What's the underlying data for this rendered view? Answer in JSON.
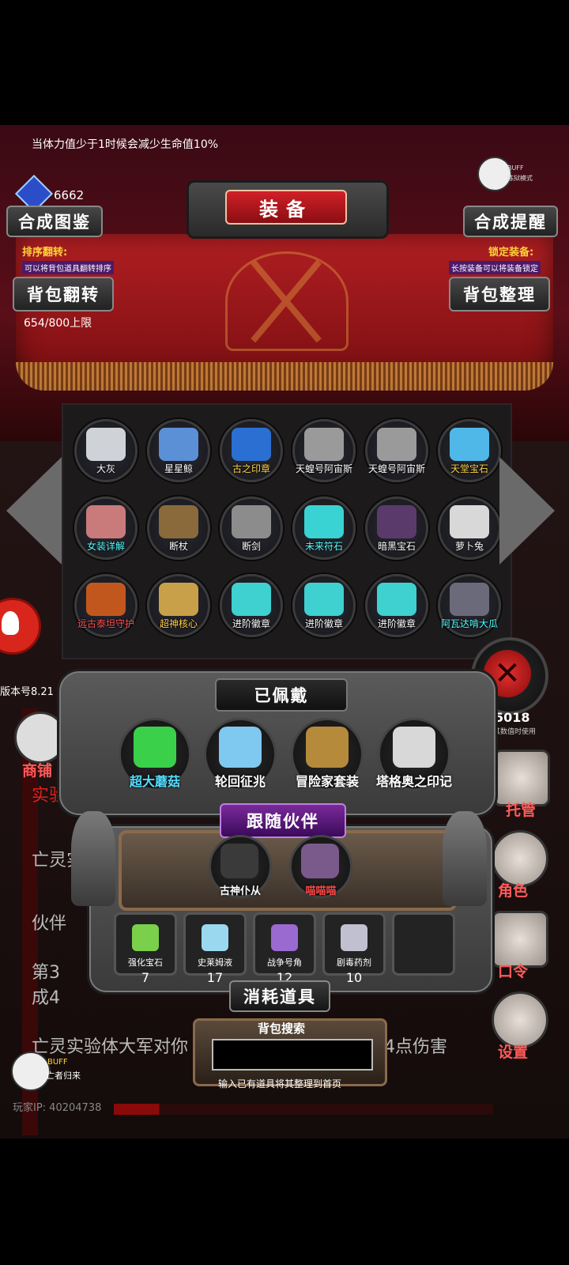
{
  "status_text": "当体力值少于1时候会减少生命值10%",
  "gems": "6662",
  "buff_top": {
    "badge": "BUFF",
    "mode": "炼狱模式"
  },
  "title": "装备",
  "buttons": {
    "synth_guide": "合成图鉴",
    "synth_remind": "合成提醒",
    "bag_flip": "背包翻转",
    "bag_sort": "背包整理"
  },
  "hints": {
    "flip_title": "排序翻转:",
    "flip_desc": "可以将背包道具翻转排序",
    "lock_title": "锁定装备:",
    "lock_desc": "长按装备可以将装备锁定"
  },
  "capacity": "654/800上限",
  "bag_items": [
    {
      "label": "大灰",
      "color": "white",
      "art": "#cfd3d8"
    },
    {
      "label": "星星鲸",
      "color": "white",
      "art": "#5b8fd6"
    },
    {
      "label": "古之印章",
      "color": "yellow",
      "art": "#2a6fd1"
    },
    {
      "label": "天蝗号阿宙斯",
      "color": "white",
      "art": "#9a9a9a"
    },
    {
      "label": "天蝗号阿宙斯",
      "color": "white",
      "art": "#9a9a9a"
    },
    {
      "label": "天堂宝石",
      "color": "yellow",
      "art": "#4fb8e8"
    },
    {
      "label": "女装详解",
      "color": "cyan",
      "art": "#c97a7a"
    },
    {
      "label": "断杖",
      "color": "white",
      "art": "#8a6a3a"
    },
    {
      "label": "断剑",
      "color": "white",
      "art": "#8c8c8c"
    },
    {
      "label": "未来符石",
      "color": "cyan",
      "art": "#39d3d3"
    },
    {
      "label": "暗黑宝石",
      "color": "white",
      "art": "#5a3a6a"
    },
    {
      "label": "萝卜兔",
      "color": "white",
      "art": "#d8d8d8"
    },
    {
      "label": "远古泰坦守护",
      "color": "red",
      "art": "#c2571e"
    },
    {
      "label": "超神核心",
      "color": "yellow",
      "art": "#c9a04a"
    },
    {
      "label": "进阶徽章",
      "color": "white",
      "art": "#3fd0d0"
    },
    {
      "label": "进阶徽章",
      "color": "white",
      "art": "#3fd0d0"
    },
    {
      "label": "进阶徽章",
      "color": "white",
      "art": "#3fd0d0"
    },
    {
      "label": "阿瓦达啃大瓜",
      "color": "cyan",
      "art": "#6a6a7a"
    }
  ],
  "version": "版本号8.21",
  "shop_label": "商铺",
  "equipped_title": "已佩戴",
  "equipped": [
    {
      "label": "超大蘑菇",
      "color": "#55ddff",
      "art": "#3ad04a"
    },
    {
      "label": "轮回征兆",
      "color": "#ffffff",
      "art": "#7fc8f0"
    },
    {
      "label": "冒险家套装",
      "color": "#ffffff",
      "art": "#b58a3a"
    },
    {
      "label": "塔格奥之印记",
      "color": "#ffffff",
      "art": "#d8d8d8"
    }
  ],
  "partner_title": "跟随伙伴",
  "partners": [
    {
      "label": "古神仆从",
      "color": "#ffffff",
      "art": "#3a3a3a"
    },
    {
      "label": "喵喵喵",
      "color": "#ff4a4a",
      "art": "#7a5a8a"
    }
  ],
  "consumables": [
    {
      "label": "强化宝石",
      "count": "7",
      "art": "#7ad04a"
    },
    {
      "label": "史莱姆液",
      "count": "17",
      "art": "#9ad8f0"
    },
    {
      "label": "战争号角",
      "count": "12",
      "art": "#9a6ad0"
    },
    {
      "label": "剧毒药剂",
      "count": "10",
      "art": "#c0c0d0"
    }
  ],
  "consumables_title": "消耗道具",
  "search": {
    "title": "背包搜索",
    "hint": "输入已有道具将其整理到首页",
    "placeholder": ""
  },
  "right_panel": {
    "value": "5018",
    "desc": "其数值时使用"
  },
  "side_labels": {
    "manage": "托管",
    "role": "角色",
    "code": "口令",
    "settings": "设置"
  },
  "bg_log": {
    "line1": "实验",
    "line2": "亡灵实",
    "line3": "伙伴",
    "line4": "第3",
    "line5": "成4",
    "line6": "亡灵实验体大军对你",
    "line6b": "4点伤害"
  },
  "buff_bottom": {
    "badge": "BUFF",
    "name": "亡者归来"
  },
  "player_ip": "玩家IP: 40204738"
}
